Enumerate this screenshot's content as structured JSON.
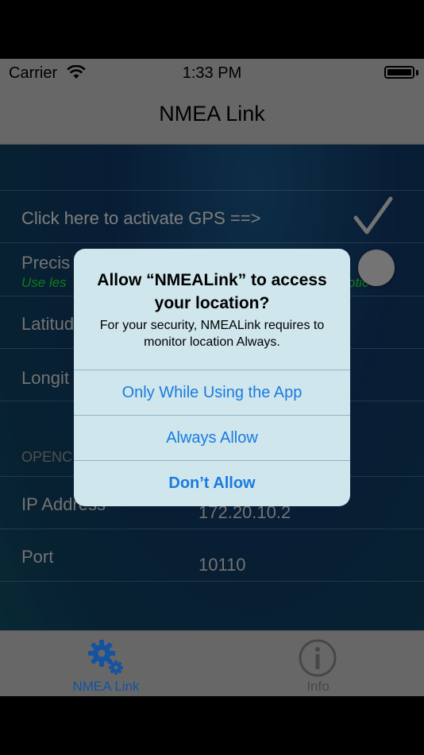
{
  "status": {
    "carrier": "Carrier",
    "time": "1:33 PM"
  },
  "nav": {
    "title": "NMEA Link"
  },
  "gps": {
    "activate_label": "Click here to activate GPS ==>",
    "precision_label": "Precis",
    "precision_note_left": "Use les",
    "precision_note_right": "otic",
    "latitude_label": "Latitud",
    "longitude_label": "Longit"
  },
  "opencpn": {
    "section_header": "OPENC",
    "ip_label": "IP Address",
    "ip_value": "172.20.10.2",
    "port_label": "Port",
    "port_value": "10110"
  },
  "alert": {
    "title": "Allow “NMEALink” to access your location?",
    "message": "For your security, NMEALink requires to monitor location Always.",
    "btn_while_using": "Only While Using the App",
    "btn_always": "Always Allow",
    "btn_dont": "Don’t Allow"
  },
  "tabs": [
    {
      "label": "NMEA Link",
      "icon": "gears-icon",
      "active": true,
      "color": "#1a6fd6"
    },
    {
      "label": "Info",
      "icon": "info-icon",
      "active": false,
      "color": "#5f5f5f"
    }
  ]
}
